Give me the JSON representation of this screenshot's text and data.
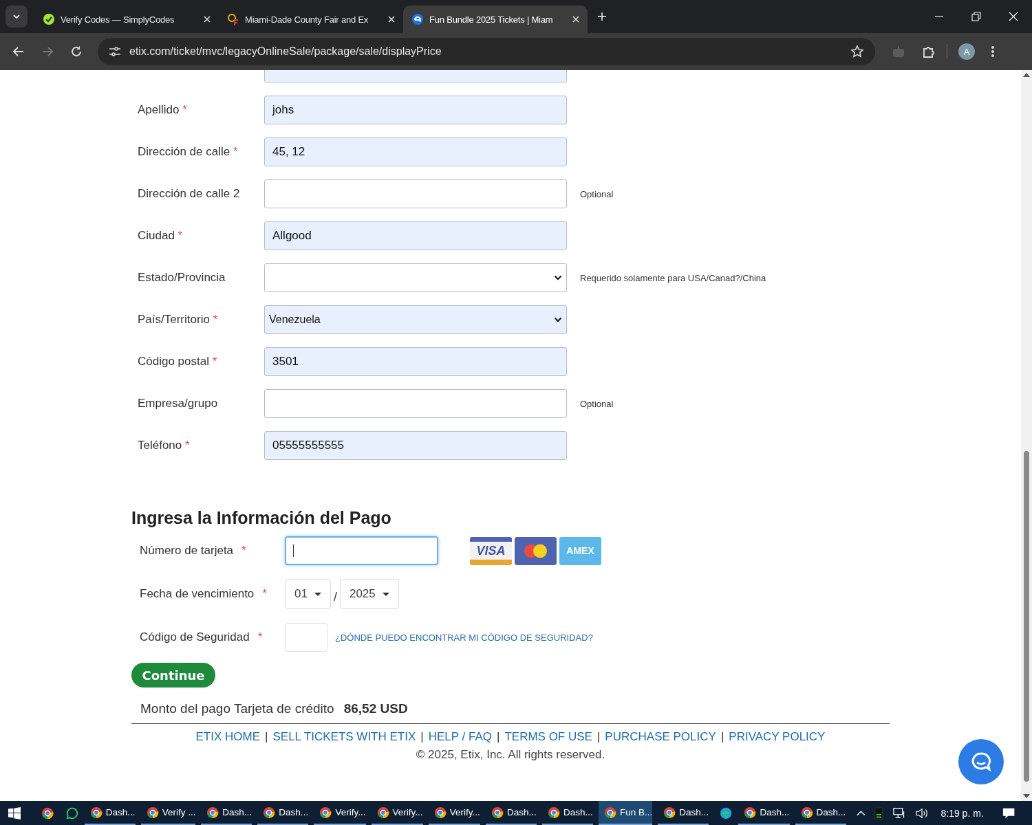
{
  "browser": {
    "tabs": [
      {
        "kind": "check",
        "title": "Verify Codes — SimplyCodes",
        "selected": false
      },
      {
        "kind": "fair",
        "title": "Miami-Dade County Fair and Ex",
        "selected": false
      },
      {
        "kind": "etix",
        "title": "Fun Bundle 2025 Tickets | Miam",
        "selected": true
      }
    ],
    "new_tab": "+",
    "url": "etix.com/ticket/mvc/legacyOnlineSale/package/sale/displayPrice",
    "profile_initial": "A"
  },
  "required_mark": "*",
  "address_form": [
    {
      "kind": "text",
      "autofilled": true
    },
    {
      "kind": "text",
      "label": "Apellido",
      "required": true,
      "autofilled": true,
      "value": "johs"
    },
    {
      "kind": "text",
      "label": "Dirección de calle",
      "required": true,
      "autofilled": true,
      "value": "45, 12"
    },
    {
      "kind": "text",
      "label": "Dirección de calle 2",
      "required": false,
      "autofilled": false,
      "note": "Optional"
    },
    {
      "kind": "text",
      "label": "Ciudad",
      "required": true,
      "autofilled": true,
      "value": "Allgood"
    },
    {
      "kind": "select",
      "label": "Estado/Provincia",
      "required": false,
      "autofilled": false,
      "note": "Requerido solamente para USA/Canad?/China"
    },
    {
      "kind": "select",
      "label": "País/Territorio",
      "required": true,
      "autofilled": true,
      "value": "Venezuela"
    },
    {
      "kind": "text",
      "label": "Código postal",
      "required": true,
      "autofilled": true,
      "value": "3501"
    },
    {
      "kind": "text",
      "label": "Empresa/grupo",
      "required": false,
      "autofilled": false,
      "note": "Optional"
    },
    {
      "kind": "text",
      "label": "Teléfono",
      "required": true,
      "autofilled": true,
      "value": "05555555555"
    }
  ],
  "payment": {
    "heading": "Ingresa la Información del Pago",
    "card_number": {
      "label": "Número de tarjeta",
      "focused": true
    },
    "cards": [
      {
        "kind": "visa",
        "text": "VISA"
      },
      {
        "kind": "mastercard"
      },
      {
        "kind": "amex",
        "text": "AMEX"
      }
    ],
    "expiry": {
      "label": "Fecha de vencimiento",
      "month": "01",
      "separator": "/",
      "year": "2025"
    },
    "security_code": {
      "label": "Código de Seguridad",
      "help_link": "¿DÓNDE PUEDO ENCONTRAR MI CÓDIGO DE SEGURIDAD?"
    },
    "continue_button": "Continue",
    "amount_label": "Monto del pago Tarjeta de crédito",
    "amount": "86,52 USD"
  },
  "footer": {
    "separator": "|",
    "links": [
      "ETIX HOME",
      "SELL TICKETS WITH ETIX",
      "HELP / FAQ",
      "TERMS OF USE",
      "PURCHASE POLICY",
      "PRIVACY POLICY"
    ],
    "copyright": "© 2025, Etix, Inc. All rights reserved."
  },
  "taskbar": {
    "items": [
      {
        "kind": "chrome",
        "label": "Dash...",
        "selected": false
      },
      {
        "kind": "chrome",
        "label": "Verify ...",
        "selected": false
      },
      {
        "kind": "chrome",
        "label": "Dash...",
        "selected": false
      },
      {
        "kind": "chrome",
        "label": "Dash...",
        "selected": false
      },
      {
        "kind": "chrome",
        "label": "Verify...",
        "selected": false
      },
      {
        "kind": "chrome",
        "label": "Verify...",
        "selected": false
      },
      {
        "kind": "chrome",
        "label": "Verify...",
        "selected": false
      },
      {
        "kind": "chrome",
        "label": "Dash...",
        "selected": false
      },
      {
        "kind": "chrome",
        "label": "Dash...",
        "selected": false
      },
      {
        "kind": "chrome",
        "label": "Fun B...",
        "selected": true
      },
      {
        "kind": "chrome",
        "label": "Dash...",
        "selected": false
      },
      {
        "kind": "edge"
      },
      {
        "kind": "chrome",
        "label": "Dash...",
        "selected": false
      },
      {
        "kind": "chrome",
        "label": "Dash...",
        "selected": false
      }
    ],
    "clock": "8:19 p. m."
  }
}
